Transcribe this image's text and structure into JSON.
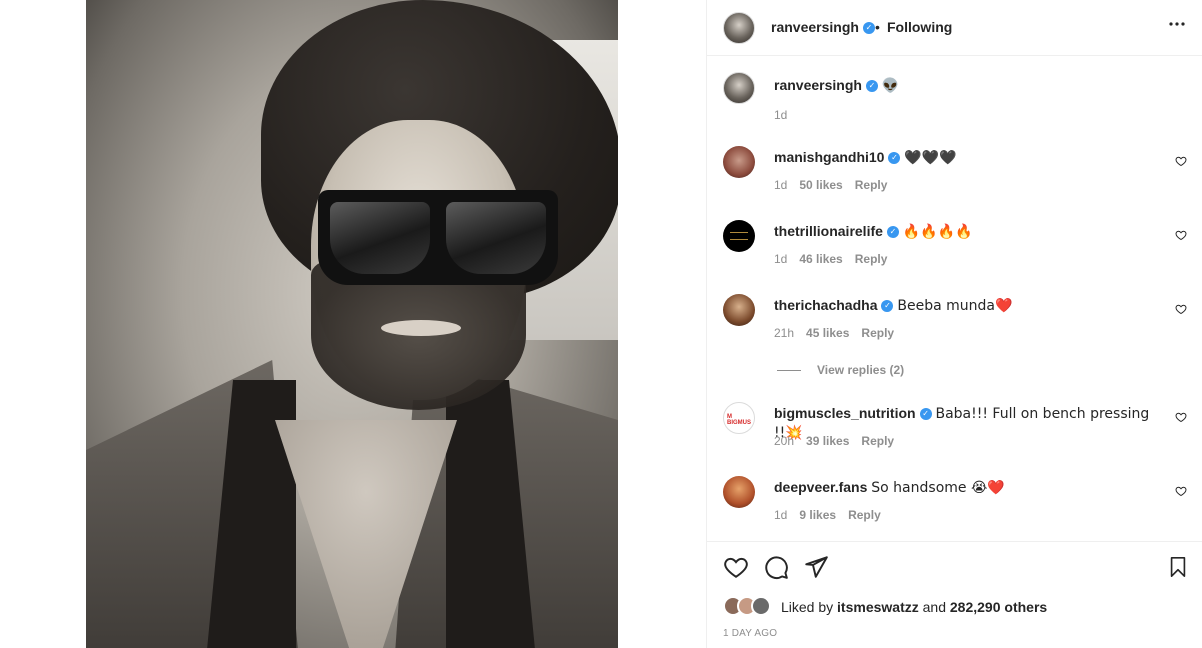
{
  "post": {
    "photo_alt": "Selfie of a man with sunglasses in a car"
  },
  "header": {
    "username": "ranveersingh",
    "verified": true,
    "separator": "•",
    "follow_status": "Following",
    "more_icon": "more-horizontal-icon"
  },
  "caption": {
    "username": "ranveersingh",
    "text": "👽",
    "time": "1d"
  },
  "comments": [
    {
      "username": "manishgandhi10",
      "verified": true,
      "text": "🖤🖤🖤",
      "time": "1d",
      "likes": "50 likes",
      "reply": "Reply"
    },
    {
      "username": "thetrillionairelife",
      "verified": true,
      "text": "🔥🔥🔥🔥",
      "time": "1d",
      "likes": "46 likes",
      "reply": "Reply"
    },
    {
      "username": "therichachadha",
      "verified": true,
      "text": "Beeba munda❤️",
      "time": "21h",
      "likes": "45 likes",
      "reply": "Reply"
    },
    {
      "username": "bigmuscles_nutrition",
      "verified": true,
      "text": "Baba!!! Full on bench pressing !!💥",
      "time": "20h",
      "likes": "39 likes",
      "reply": "Reply"
    },
    {
      "username": "deepveer.fans",
      "verified": false,
      "text": "So handsome 😭❤️",
      "time": "1d",
      "likes": "9 likes",
      "reply": "Reply"
    }
  ],
  "view_replies": "View replies (2)",
  "actions": {
    "like_icon": "heart-icon",
    "comment_icon": "comment-icon",
    "share_icon": "send-icon",
    "save_icon": "bookmark-icon"
  },
  "likes": {
    "prefix": "Liked by",
    "user": "itsmeswatzz",
    "conj": "and",
    "others": "282,290 others"
  },
  "timestamp": "1 DAY AGO",
  "colors": {
    "text": "#262626",
    "secondary": "#8e8e8e",
    "verified": "#3897f0",
    "heart": "#ed4956"
  }
}
